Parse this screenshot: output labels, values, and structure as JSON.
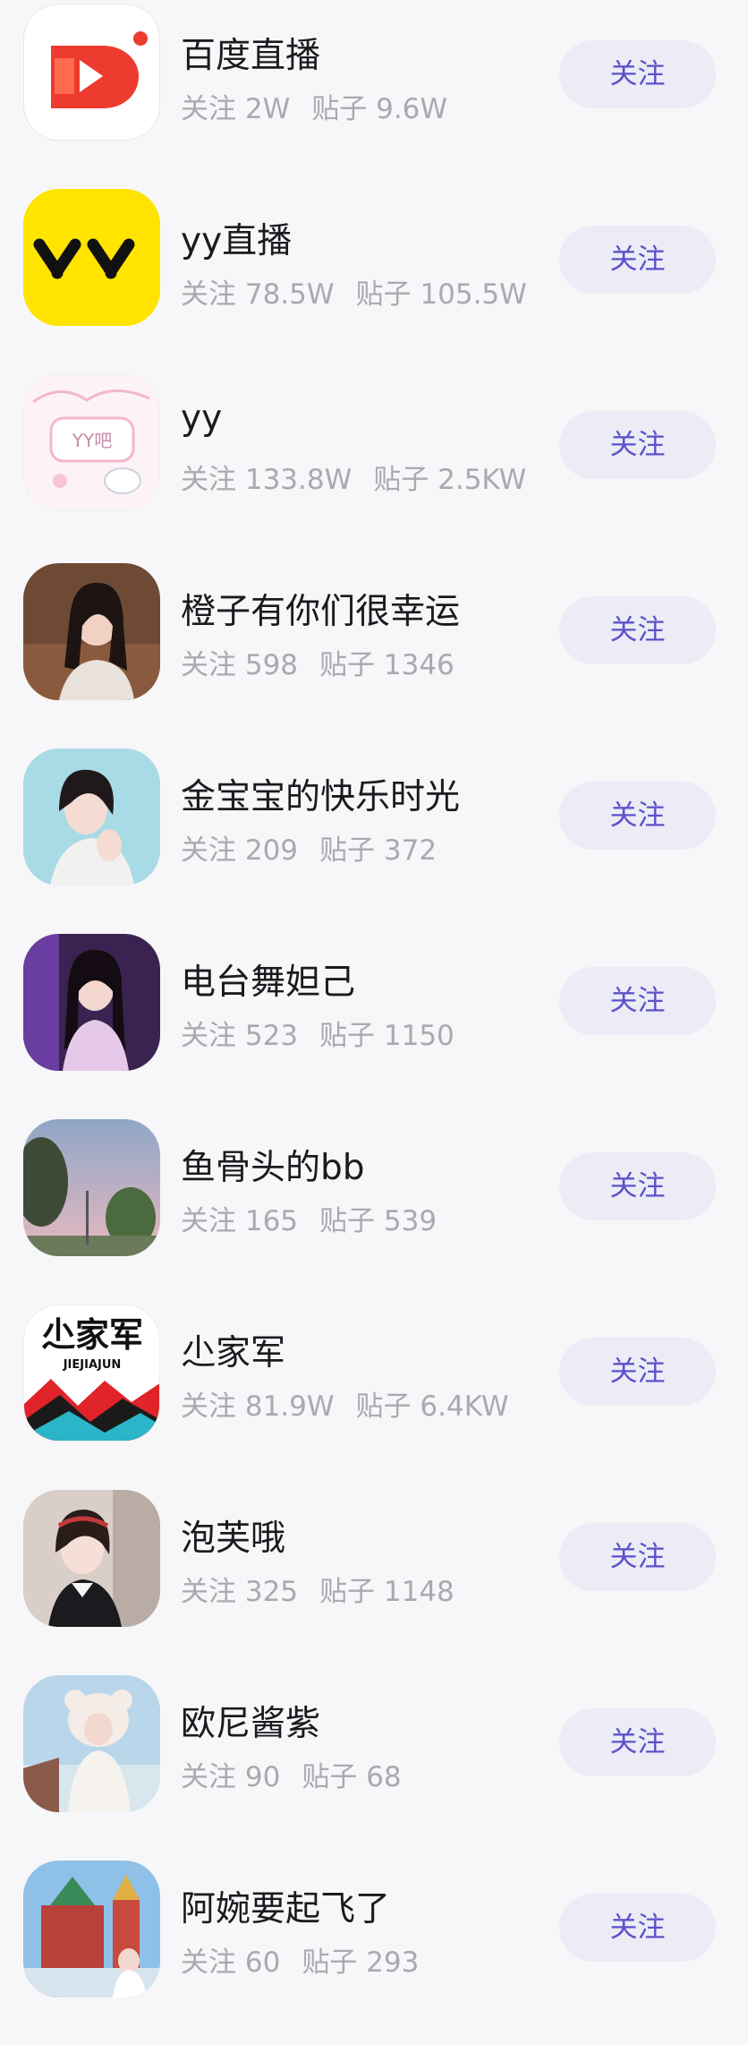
{
  "labels": {
    "follow_prefix": "关注",
    "posts_prefix": "贴子"
  },
  "forums": [
    {
      "name": "百度直播",
      "follows": "2W",
      "posts": "9.6W",
      "button": "关注",
      "avatar": "baidu-live-logo-icon"
    },
    {
      "name": "yy直播",
      "follows": "78.5W",
      "posts": "105.5W",
      "button": "关注",
      "avatar": "yy-logo-icon"
    },
    {
      "name": "yy",
      "follows": "133.8W",
      "posts": "2.5KW",
      "button": "关注",
      "avatar": "yy-bar-sticker-icon"
    },
    {
      "name": "橙子有你们很幸运",
      "follows": "598",
      "posts": "1346",
      "button": "关注",
      "avatar": "user-photo"
    },
    {
      "name": "金宝宝的快乐时光",
      "follows": "209",
      "posts": "372",
      "button": "关注",
      "avatar": "user-photo"
    },
    {
      "name": "电台舞妲己",
      "follows": "523",
      "posts": "1150",
      "button": "关注",
      "avatar": "user-photo"
    },
    {
      "name": "鱼骨头的bb",
      "follows": "165",
      "posts": "539",
      "button": "关注",
      "avatar": "landscape-photo"
    },
    {
      "name": "尐家军",
      "follows": "81.9W",
      "posts": "6.4KW",
      "button": "关注",
      "avatar": "jiejiajun-logo-icon"
    },
    {
      "name": "泡芙哦",
      "follows": "325",
      "posts": "1148",
      "button": "关注",
      "avatar": "user-photo"
    },
    {
      "name": "欧尼酱紫",
      "follows": "90",
      "posts": "68",
      "button": "关注",
      "avatar": "user-photo"
    },
    {
      "name": "阿婉要起飞了",
      "follows": "60",
      "posts": "293",
      "button": "关注",
      "avatar": "user-photo"
    }
  ],
  "logo_text": {
    "yy": "YY",
    "yy_bar": "YY吧",
    "jiejiajun_cn": "尐家军",
    "jiejiajun_en": "JIEJIAJUN"
  },
  "colors": {
    "background": "#f7f7f9",
    "button_bg": "#ecebf6",
    "button_text": "#5b52c9",
    "name_text": "#1b1b1f",
    "stat_text": "#a9a9b0",
    "baidu_red": "#ee3b2f",
    "yy_yellow": "#ffe400"
  }
}
